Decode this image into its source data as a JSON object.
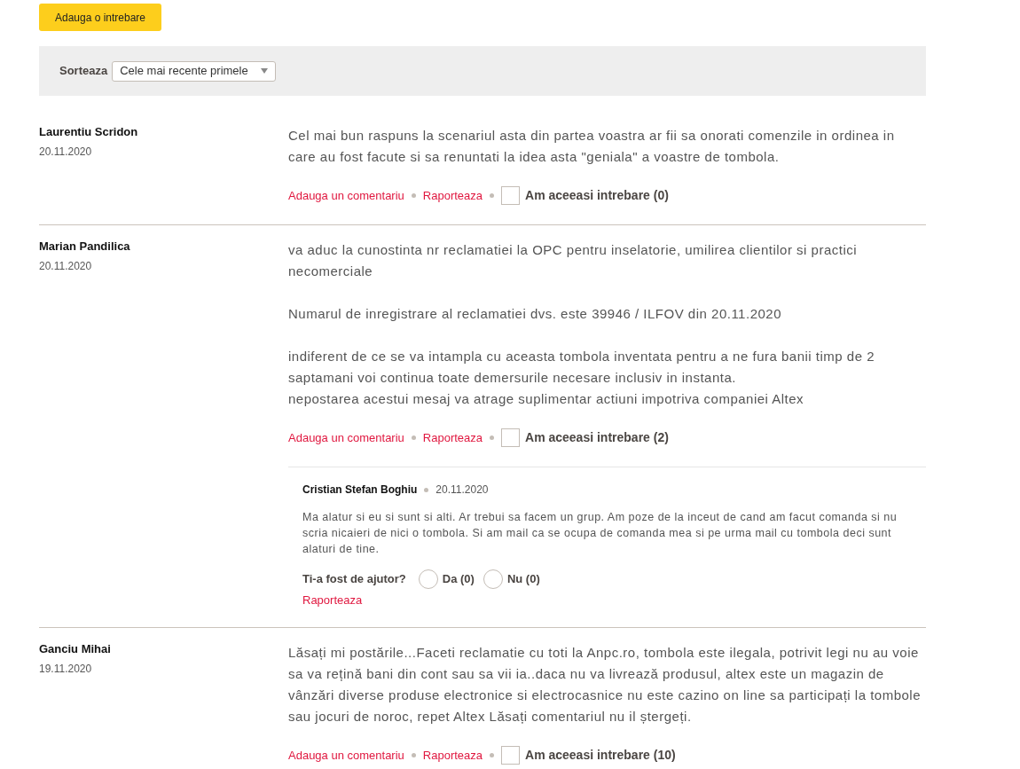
{
  "add_question_button": {
    "label": "Adauga o intrebare"
  },
  "sort": {
    "label": "Sorteaza",
    "value": "Cele mai recente primele"
  },
  "questions": [
    {
      "author": "Laurentiu Scridon",
      "date": "20.11.2020",
      "text": "Cel mai bun raspuns la scenariul asta din partea voastra ar fii sa onorati comenzile in ordinea in care au fost facute si sa renuntati la idea asta \"geniala\" a voastre de tombola.",
      "actions": {
        "comment_link": "Adauga un comentariu",
        "report_link": "Raporteaza",
        "same_question": {
          "label": "Am aceeasi intrebare (0)",
          "checked": false
        }
      }
    },
    {
      "author": "Marian Pandilica",
      "date": "20.11.2020",
      "text": "va aduc la cunostinta nr reclamatiei la OPC pentru inselatorie, umilirea clientilor si practici necomerciale\n\nNumarul de inregistrare al reclamatiei dvs. este 39946 / ILFOV din 20.11.2020\n\nindiferent de ce se va intampla cu aceasta tombola inventata pentru a ne fura banii timp de 2 saptamani voi continua toate demersurile necesare inclusiv in instanta.\nnepostarea acestui mesaj va atrage suplimentar actiuni impotriva companiei Altex",
      "actions": {
        "comment_link": "Adauga un comentariu",
        "report_link": "Raporteaza",
        "same_question": {
          "label": "Am aceeasi intrebare (2)",
          "checked": false
        }
      },
      "comments": [
        {
          "author": "Cristian Stefan Boghiu",
          "date": "20.11.2020",
          "text": "Ma alatur si eu si sunt si alti. Ar trebui sa facem un grup. Am poze de la inceut de cand am facut comanda si nu scria nicaieri de nici o tombola. Si am mail ca se ocupa de comanda mea si pe urma mail cu tombola deci sunt alaturi de tine.",
          "helpful": {
            "label": "Ti-a fost de ajutor?",
            "options": [
              {
                "label": "Da (0)",
                "selected": false
              },
              {
                "label": "Nu (0)",
                "selected": false
              }
            ]
          },
          "report_link": "Raporteaza"
        }
      ]
    },
    {
      "author": "Ganciu Mihai",
      "date": "19.11.2020",
      "text": "Lăsați mi postările...Faceti reclamatie cu toti la Anpc.ro, tombola este ilegala, potrivit legi nu au voie sa va rețină bani din cont sau sa vii ia..daca nu va livrează produsul, altex este un magazin de vânzări diverse produse electronice si electrocasnice nu este cazino on line sa participați la tombole sau jocuri de noroc, repet Altex Lăsați comentariul nu il ștergeți.",
      "actions": {
        "comment_link": "Adauga un comentariu",
        "report_link": "Raporteaza",
        "same_question": {
          "label": "Am aceeasi intrebare (10)",
          "checked": false
        }
      }
    }
  ]
}
